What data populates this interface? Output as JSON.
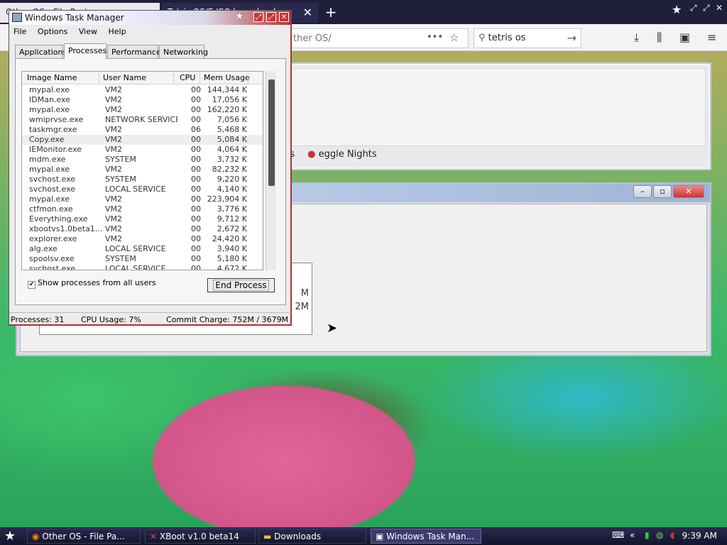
{
  "firefox": {
    "tab1_label": "Other OS - File Paste",
    "tab2_label": "Tetris OS/E ISO.box - h.ml",
    "url_text": "ther OS/",
    "search_value": "tetris os",
    "bookmark_text_1": "ds",
    "bookmark_text_2": "eggle Nights"
  },
  "behind_window": {
    "text_1": "M",
    "text_2": "2M"
  },
  "task_manager": {
    "title": "Windows Task Manager",
    "menu": [
      "File",
      "Options",
      "View",
      "Help"
    ],
    "tabs": [
      "Applications",
      "Processes",
      "Performance",
      "Networking"
    ],
    "active_tab": "Processes",
    "columns": [
      "Image Name",
      "User Name",
      "CPU",
      "Mem Usage"
    ],
    "processes": [
      {
        "name": "mypal.exe",
        "user": "VM2",
        "cpu": "00",
        "mem": "144,344 K"
      },
      {
        "name": "IDMan.exe",
        "user": "VM2",
        "cpu": "00",
        "mem": "17,056 K"
      },
      {
        "name": "mypal.exe",
        "user": "VM2",
        "cpu": "00",
        "mem": "162,220 K"
      },
      {
        "name": "wmiprvse.exe",
        "user": "NETWORK SERVICE",
        "cpu": "00",
        "mem": "7,056 K"
      },
      {
        "name": "taskmgr.exe",
        "user": "VM2",
        "cpu": "06",
        "mem": "5,468 K"
      },
      {
        "name": "Copy.exe",
        "user": "VM2",
        "cpu": "00",
        "mem": "5,084 K"
      },
      {
        "name": "IEMonitor.exe",
        "user": "VM2",
        "cpu": "00",
        "mem": "4,064 K"
      },
      {
        "name": "mdm.exe",
        "user": "SYSTEM",
        "cpu": "00",
        "mem": "3,732 K"
      },
      {
        "name": "mypal.exe",
        "user": "VM2",
        "cpu": "00",
        "mem": "82,232 K"
      },
      {
        "name": "svchost.exe",
        "user": "SYSTEM",
        "cpu": "00",
        "mem": "9,220 K"
      },
      {
        "name": "svchost.exe",
        "user": "LOCAL SERVICE",
        "cpu": "00",
        "mem": "4,140 K"
      },
      {
        "name": "mypal.exe",
        "user": "VM2",
        "cpu": "00",
        "mem": "223,904 K"
      },
      {
        "name": "ctfmon.exe",
        "user": "VM2",
        "cpu": "00",
        "mem": "3,776 K"
      },
      {
        "name": "Everything.exe",
        "user": "VM2",
        "cpu": "00",
        "mem": "9,712 K"
      },
      {
        "name": "xbootvs1.0beta1...",
        "user": "VM2",
        "cpu": "00",
        "mem": "2,672 K"
      },
      {
        "name": "explorer.exe",
        "user": "VM2",
        "cpu": "00",
        "mem": "24,420 K"
      },
      {
        "name": "alg.exe",
        "user": "LOCAL SERVICE",
        "cpu": "00",
        "mem": "3,940 K"
      },
      {
        "name": "spoolsv.exe",
        "user": "SYSTEM",
        "cpu": "00",
        "mem": "5,180 K"
      },
      {
        "name": "svchost.exe",
        "user": "LOCAL SERVICE",
        "cpu": "00",
        "mem": "4,672 K"
      }
    ],
    "show_all_label": "Show processes from all users",
    "show_all_checked": true,
    "end_process_label": "End Process",
    "status_processes": "Processes: 31",
    "status_cpu": "CPU Usage: 7%",
    "status_commit": "Commit Charge: 752M / 3679M"
  },
  "taskbar": {
    "items": [
      "Other OS - File Pa...",
      "XBoot v1.0 beta14",
      "Downloads",
      "Windows Task Man..."
    ],
    "active_item": "Windows Task Man...",
    "clock": "9:39 AM"
  }
}
